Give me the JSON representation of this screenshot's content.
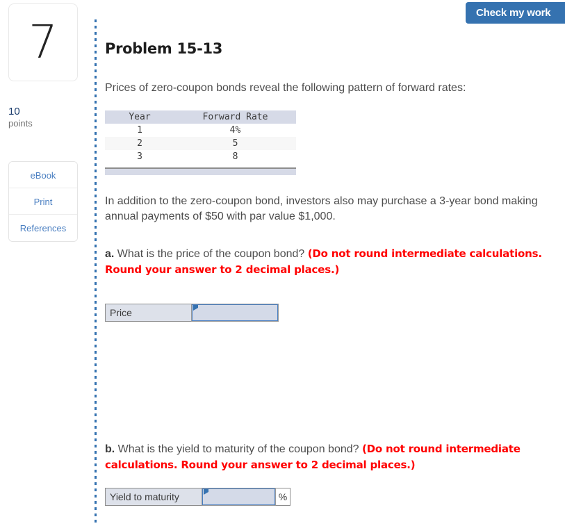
{
  "header": {
    "check_work_label": "Check my work"
  },
  "sidebar": {
    "question_number": "7",
    "points_value": "10",
    "points_label": "points",
    "tools": [
      {
        "label": "eBook",
        "name": "ebook-button"
      },
      {
        "label": "Print",
        "name": "print-button"
      },
      {
        "label": "References",
        "name": "references-button"
      }
    ]
  },
  "main": {
    "title": "Problem 15-13",
    "intro": "Prices of zero-coupon bonds reveal the following pattern of forward rates:",
    "addition": "In addition to the zero-coupon bond, investors also may purchase a 3-year bond making annual payments of $50 with par value $1,000.",
    "table": {
      "columns": [
        "Year",
        "Forward Rate"
      ],
      "rows": [
        [
          "1",
          "4%"
        ],
        [
          "2",
          "5"
        ],
        [
          "3",
          "8"
        ]
      ]
    },
    "questions": [
      {
        "letter": "a.",
        "text": " What is the price of the coupon bond? ",
        "hint": "(Do not round intermediate calculations. Round your answer to 2 decimal places.)",
        "answer_label": "Price",
        "answer_value": "",
        "unit": ""
      },
      {
        "letter": "b.",
        "text": " What is the yield to maturity of the coupon bond? ",
        "hint": "(Do not round intermediate calculations. Round your answer to 2 decimal places.)",
        "answer_label": "Yield to maturity",
        "answer_value": "",
        "unit": "%"
      }
    ]
  },
  "colors": {
    "accent_blue": "#3572b0",
    "hint_red": "#ff0000",
    "table_header": "#d6dae7",
    "input_fill": "#d4dae8",
    "label_fill": "#dde1ea"
  }
}
